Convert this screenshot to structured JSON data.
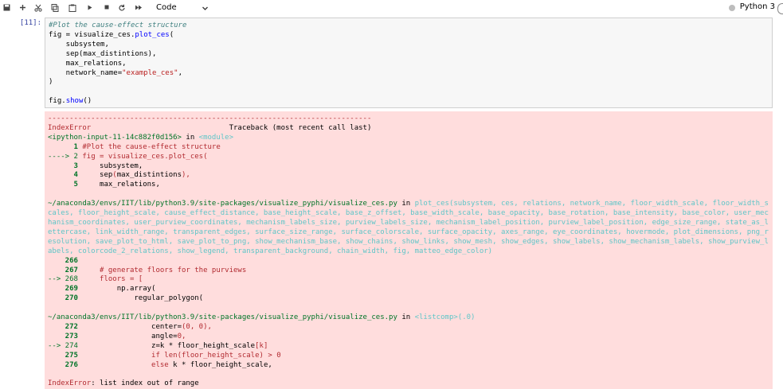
{
  "toolbar": {
    "icons": [
      "save-icon",
      "add-cell-icon",
      "cut-icon",
      "copy-icon",
      "paste-icon",
      "run-icon",
      "stop-icon",
      "restart-icon",
      "fast-forward-icon"
    ],
    "cell_type": "Code",
    "kernel_name": "Python 3"
  },
  "cell": {
    "prompt": "[11]:",
    "code_lines": [
      "#Plot the cause-effect structure",
      "fig = visualize_ces.plot_ces(",
      "    subsystem,",
      "    sep(max_distintions),",
      "    max_relations,",
      "    network_name=\"example_ces\",",
      ")",
      "",
      "fig.show()"
    ]
  },
  "output": {
    "dashes": "---------------------------------------------------------------------------",
    "error_name": "IndexError",
    "traceback_header": "Traceback (most recent call last)",
    "input_ref": "<ipython-input-11-14c882f0d156>",
    "in_word": " in ",
    "module": "<module>",
    "frame1_lines": [
      "      1 #Plot the cause-effect structure",
      "----> 2 fig = visualize_ces.plot_ces(",
      "      3     subsystem,",
      "      4     sep(max_distintions),",
      "      5     max_relations,"
    ],
    "file_path": "~/anaconda3/envs/IIT/lib/python3.9/site-packages/visualize_pyphi/visualize_ces.py",
    "func_sig_1": "plot_ces(subsystem, ces, relations, network_name, floor_width_scale, floor_width_s",
    "func_sig_2": "cales, floor_height_scale, cause_effect_distance, base_height_scale, base_z_offset, base_width_scale, base_opacity, base_rotation, base_intensity, base_color, user_mec",
    "func_sig_3": "hanism_coordinates, user_purview_coordinates, mechanism_labels_size, purview_labels_size, mechanism_label_position, purview_label_position, edge_size_range, state_as_l",
    "func_sig_4": "ettercase, link_width_range, transparent_edges, surface_size_range, surface_colorscale, surface_opacity, axes_range, eye_coordinates, hovermode, plot_dimensions, png_r",
    "func_sig_5": "esolution, save_plot_to_html, save_plot_to_png, show_mechanism_base, show_chains, show_links, show_mesh, show_edges, show_labels, show_mechanism_labels, show_purview_l",
    "func_sig_6": "abels, colorcode_2_relations, show_legend, transparent_background, chain_width, fig, matteo_edge_color)",
    "frame2_lines": [
      "    266 ",
      "    267     # generate floors for the purviews",
      "--> 268     floors = [",
      "    269         np.array(",
      "    270             regular_polygon("
    ],
    "listcomp": "<listcomp>(.0)",
    "frame3_lines": [
      "    272                 center=(0, 0),",
      "    273                 angle=0,",
      "--> 274                 z=k * floor_height_scale[k]",
      "    275                 if len(floor_height_scale) > 0",
      "    276                 else k * floor_height_scale,"
    ],
    "final_error": "IndexError",
    "final_message": ": list index out of range"
  }
}
